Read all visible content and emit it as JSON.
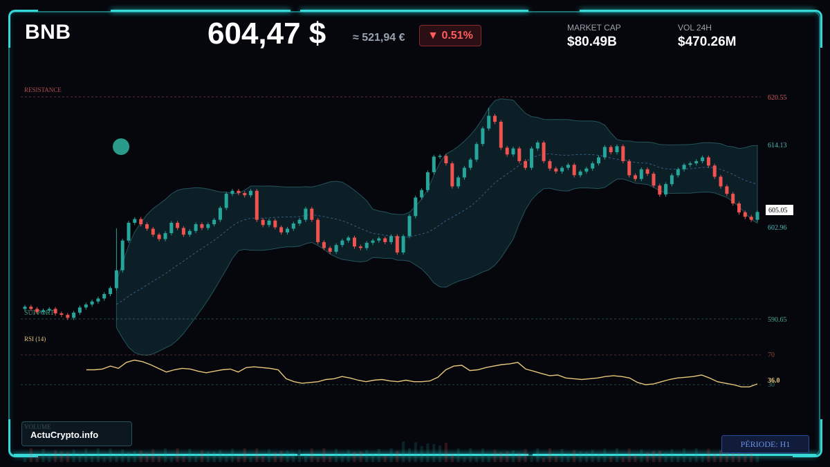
{
  "header": {
    "asset": "BNB",
    "price": "604,47 $",
    "price_eur": "≈ 521,94 €",
    "change": "▼ 0.51%",
    "market_cap_label": "MARKET CAP",
    "market_cap_value": "$80.49B",
    "volume_label": "VOL 24H",
    "volume_value": "$470.26M"
  },
  "chart_labels": {
    "resistance": "RESISTANCE",
    "support": "SUPPORT",
    "rsi": "RSI (14)",
    "volume": "VOLUME",
    "rsi_value": "36.0",
    "rsi_70": "70",
    "rsi_30": "30"
  },
  "footer": {
    "brand": "ActuCrypto.info",
    "period": "PÉRIODE: H1"
  },
  "colors": {
    "up": "#26a69a",
    "down": "#ef5350",
    "accent": "#38d9d9",
    "rsi_line": "#e8c77a",
    "resistance": "#d45a5a",
    "support": "#4fa88f"
  },
  "chart_data": {
    "type": "candlestick",
    "y_ticks": [
      "620.55",
      "614.13",
      "605.05",
      "602.96",
      "590.65"
    ],
    "resistance": 620.55,
    "support": 590.65,
    "current_price": 605.05,
    "ylim": [
      589.0,
      622.0
    ],
    "closes": [
      592.3,
      592.0,
      591.6,
      591.8,
      592.0,
      591.4,
      591.2,
      590.8,
      591.5,
      592.2,
      592.6,
      593.0,
      593.4,
      594.0,
      594.8,
      597.2,
      601.2,
      603.6,
      604.1,
      603.4,
      602.8,
      602.0,
      601.4,
      602.2,
      603.6,
      602.9,
      602.0,
      602.5,
      603.4,
      602.9,
      603.4,
      604.0,
      605.6,
      607.5,
      607.9,
      607.6,
      607.3,
      607.9,
      604.0,
      603.3,
      603.9,
      603.0,
      602.3,
      602.8,
      603.5,
      604.0,
      605.5,
      604.0,
      601.0,
      600.2,
      599.7,
      600.6,
      601.2,
      601.6,
      600.4,
      600.2,
      600.9,
      601.2,
      601.5,
      601.0,
      601.8,
      599.6,
      601.8,
      604.5,
      607.0,
      608.0,
      610.4,
      612.5,
      612.6,
      611.6,
      608.5,
      609.7,
      611.0,
      612.1,
      614.2,
      616.3,
      618.0,
      617.2,
      613.7,
      612.8,
      613.6,
      611.9,
      611.0,
      613.6,
      614.4,
      611.9,
      610.9,
      610.5,
      611.0,
      611.4,
      610.0,
      610.5,
      610.9,
      611.6,
      612.4,
      613.8,
      613.1,
      613.9,
      611.9,
      610.0,
      609.5,
      610.8,
      610.2,
      608.6,
      607.4,
      608.8,
      610.0,
      610.8,
      611.4,
      611.6,
      611.9,
      612.4,
      611.3,
      609.8,
      608.5,
      607.5,
      606.2,
      605.0,
      604.4,
      604.0,
      605.05
    ],
    "volume": "shown as faint bars (values not printed)",
    "rsi": {
      "period": 14,
      "levels": [
        70,
        30
      ],
      "last": 36.0,
      "values": [
        50,
        50,
        51,
        55,
        52,
        60,
        63,
        61,
        57,
        52,
        47,
        50,
        52,
        51,
        48,
        46,
        48,
        50,
        51,
        47,
        53,
        54,
        53,
        52,
        50,
        38,
        34,
        32,
        33,
        34,
        37,
        38,
        41,
        39,
        36,
        34,
        36,
        37,
        35,
        34,
        36,
        34,
        34,
        35,
        40,
        50,
        55,
        56,
        49,
        50,
        53,
        55,
        57,
        58,
        60,
        51,
        48,
        45,
        42,
        43,
        39,
        38,
        37,
        38,
        39,
        41,
        42,
        41,
        39,
        33,
        30,
        31,
        34,
        37,
        39,
        40,
        41,
        43,
        39,
        34,
        32,
        30,
        27,
        27,
        31
      ]
    }
  }
}
